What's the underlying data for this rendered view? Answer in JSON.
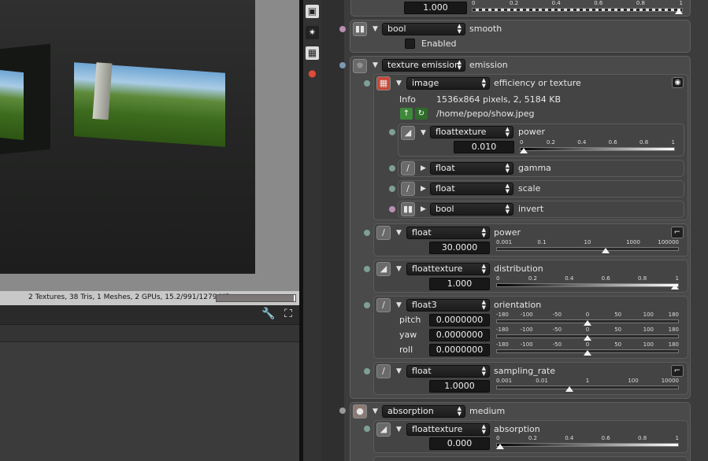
{
  "viewport": {
    "status": "2 Textures, 38 Tris, 1 Meshes, 2 GPUs, 15.2/991/1279 MB",
    "gpu_memory_fraction": 0.98
  },
  "sidebar_icons": [
    "image-icon",
    "sun-icon",
    "texture-icon",
    "material-icon"
  ],
  "top_row": {
    "value": "1.000",
    "ticks": [
      "0",
      "0.2",
      "0.4",
      "0.6",
      "0.8",
      "1"
    ],
    "thumb": 1.0
  },
  "smooth": {
    "type": "bool",
    "name": "smooth",
    "checkbox_label": "Enabled"
  },
  "emission": {
    "type": "texture emission",
    "name": "emission",
    "image": {
      "type": "image",
      "name": "efficiency or texture",
      "info_label": "Info",
      "info_value": "1536x864 pixels, 2, 5184 KB",
      "path": "/home/pepo/show.jpeg"
    },
    "power_tex": {
      "type": "floattexture",
      "name": "power",
      "value": "0.010",
      "ticks": [
        "0",
        "0.2",
        "0.4",
        "0.6",
        "0.8",
        "1"
      ],
      "thumb": 0.0
    },
    "gamma": {
      "type": "float",
      "name": "gamma"
    },
    "scale": {
      "type": "float",
      "name": "scale"
    },
    "invert": {
      "type": "bool",
      "name": "invert"
    },
    "power": {
      "type": "float",
      "name": "power",
      "value": "30.0000",
      "ticks": [
        "0.001",
        "0.1",
        "10",
        "1000",
        "100000"
      ],
      "thumb": 0.6
    },
    "distribution": {
      "type": "floattexture",
      "name": "distribution",
      "value": "1.000",
      "ticks": [
        "0",
        "0.2",
        "0.4",
        "0.6",
        "0.8",
        "1"
      ],
      "thumb": 1.0
    },
    "orientation": {
      "type": "float3",
      "name": "orientation",
      "ticks": [
        "-180",
        "-100",
        "-50",
        "0",
        "50",
        "100",
        "180"
      ],
      "rows": [
        {
          "label": "pitch",
          "value": "0.0000000",
          "thumb": 0.5
        },
        {
          "label": "yaw",
          "value": "0.0000000",
          "thumb": 0.5
        },
        {
          "label": "roll",
          "value": "0.0000000",
          "thumb": 0.5
        }
      ]
    },
    "sampling_rate": {
      "type": "float",
      "name": "sampling_rate",
      "value": "1.0000",
      "ticks": [
        "0.001",
        "0.01",
        "1",
        "100",
        "10000"
      ],
      "thumb": 0.4
    }
  },
  "medium": {
    "type": "absorption",
    "name": "medium",
    "absorption": {
      "type": "floattexture",
      "name": "absorption",
      "value": "0.000",
      "ticks": [
        "0",
        "0.2",
        "0.4",
        "0.6",
        "0.8",
        "1"
      ],
      "thumb": 0.0
    }
  }
}
